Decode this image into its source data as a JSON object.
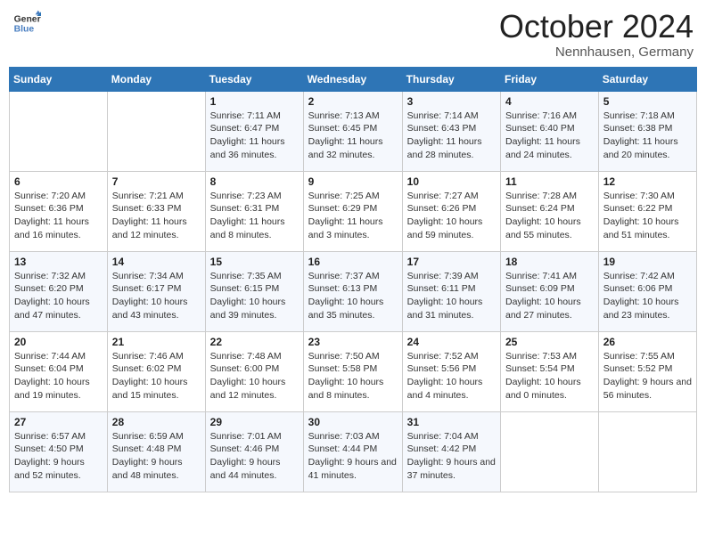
{
  "header": {
    "logo_line1": "General",
    "logo_line2": "Blue",
    "month": "October 2024",
    "location": "Nennhausen, Germany"
  },
  "days_of_week": [
    "Sunday",
    "Monday",
    "Tuesday",
    "Wednesday",
    "Thursday",
    "Friday",
    "Saturday"
  ],
  "weeks": [
    [
      {
        "day": "",
        "info": ""
      },
      {
        "day": "",
        "info": ""
      },
      {
        "day": "1",
        "info": "Sunrise: 7:11 AM\nSunset: 6:47 PM\nDaylight: 11 hours and 36 minutes."
      },
      {
        "day": "2",
        "info": "Sunrise: 7:13 AM\nSunset: 6:45 PM\nDaylight: 11 hours and 32 minutes."
      },
      {
        "day": "3",
        "info": "Sunrise: 7:14 AM\nSunset: 6:43 PM\nDaylight: 11 hours and 28 minutes."
      },
      {
        "day": "4",
        "info": "Sunrise: 7:16 AM\nSunset: 6:40 PM\nDaylight: 11 hours and 24 minutes."
      },
      {
        "day": "5",
        "info": "Sunrise: 7:18 AM\nSunset: 6:38 PM\nDaylight: 11 hours and 20 minutes."
      }
    ],
    [
      {
        "day": "6",
        "info": "Sunrise: 7:20 AM\nSunset: 6:36 PM\nDaylight: 11 hours and 16 minutes."
      },
      {
        "day": "7",
        "info": "Sunrise: 7:21 AM\nSunset: 6:33 PM\nDaylight: 11 hours and 12 minutes."
      },
      {
        "day": "8",
        "info": "Sunrise: 7:23 AM\nSunset: 6:31 PM\nDaylight: 11 hours and 8 minutes."
      },
      {
        "day": "9",
        "info": "Sunrise: 7:25 AM\nSunset: 6:29 PM\nDaylight: 11 hours and 3 minutes."
      },
      {
        "day": "10",
        "info": "Sunrise: 7:27 AM\nSunset: 6:26 PM\nDaylight: 10 hours and 59 minutes."
      },
      {
        "day": "11",
        "info": "Sunrise: 7:28 AM\nSunset: 6:24 PM\nDaylight: 10 hours and 55 minutes."
      },
      {
        "day": "12",
        "info": "Sunrise: 7:30 AM\nSunset: 6:22 PM\nDaylight: 10 hours and 51 minutes."
      }
    ],
    [
      {
        "day": "13",
        "info": "Sunrise: 7:32 AM\nSunset: 6:20 PM\nDaylight: 10 hours and 47 minutes."
      },
      {
        "day": "14",
        "info": "Sunrise: 7:34 AM\nSunset: 6:17 PM\nDaylight: 10 hours and 43 minutes."
      },
      {
        "day": "15",
        "info": "Sunrise: 7:35 AM\nSunset: 6:15 PM\nDaylight: 10 hours and 39 minutes."
      },
      {
        "day": "16",
        "info": "Sunrise: 7:37 AM\nSunset: 6:13 PM\nDaylight: 10 hours and 35 minutes."
      },
      {
        "day": "17",
        "info": "Sunrise: 7:39 AM\nSunset: 6:11 PM\nDaylight: 10 hours and 31 minutes."
      },
      {
        "day": "18",
        "info": "Sunrise: 7:41 AM\nSunset: 6:09 PM\nDaylight: 10 hours and 27 minutes."
      },
      {
        "day": "19",
        "info": "Sunrise: 7:42 AM\nSunset: 6:06 PM\nDaylight: 10 hours and 23 minutes."
      }
    ],
    [
      {
        "day": "20",
        "info": "Sunrise: 7:44 AM\nSunset: 6:04 PM\nDaylight: 10 hours and 19 minutes."
      },
      {
        "day": "21",
        "info": "Sunrise: 7:46 AM\nSunset: 6:02 PM\nDaylight: 10 hours and 15 minutes."
      },
      {
        "day": "22",
        "info": "Sunrise: 7:48 AM\nSunset: 6:00 PM\nDaylight: 10 hours and 12 minutes."
      },
      {
        "day": "23",
        "info": "Sunrise: 7:50 AM\nSunset: 5:58 PM\nDaylight: 10 hours and 8 minutes."
      },
      {
        "day": "24",
        "info": "Sunrise: 7:52 AM\nSunset: 5:56 PM\nDaylight: 10 hours and 4 minutes."
      },
      {
        "day": "25",
        "info": "Sunrise: 7:53 AM\nSunset: 5:54 PM\nDaylight: 10 hours and 0 minutes."
      },
      {
        "day": "26",
        "info": "Sunrise: 7:55 AM\nSunset: 5:52 PM\nDaylight: 9 hours and 56 minutes."
      }
    ],
    [
      {
        "day": "27",
        "info": "Sunrise: 6:57 AM\nSunset: 4:50 PM\nDaylight: 9 hours and 52 minutes."
      },
      {
        "day": "28",
        "info": "Sunrise: 6:59 AM\nSunset: 4:48 PM\nDaylight: 9 hours and 48 minutes."
      },
      {
        "day": "29",
        "info": "Sunrise: 7:01 AM\nSunset: 4:46 PM\nDaylight: 9 hours and 44 minutes."
      },
      {
        "day": "30",
        "info": "Sunrise: 7:03 AM\nSunset: 4:44 PM\nDaylight: 9 hours and 41 minutes."
      },
      {
        "day": "31",
        "info": "Sunrise: 7:04 AM\nSunset: 4:42 PM\nDaylight: 9 hours and 37 minutes."
      },
      {
        "day": "",
        "info": ""
      },
      {
        "day": "",
        "info": ""
      }
    ]
  ]
}
